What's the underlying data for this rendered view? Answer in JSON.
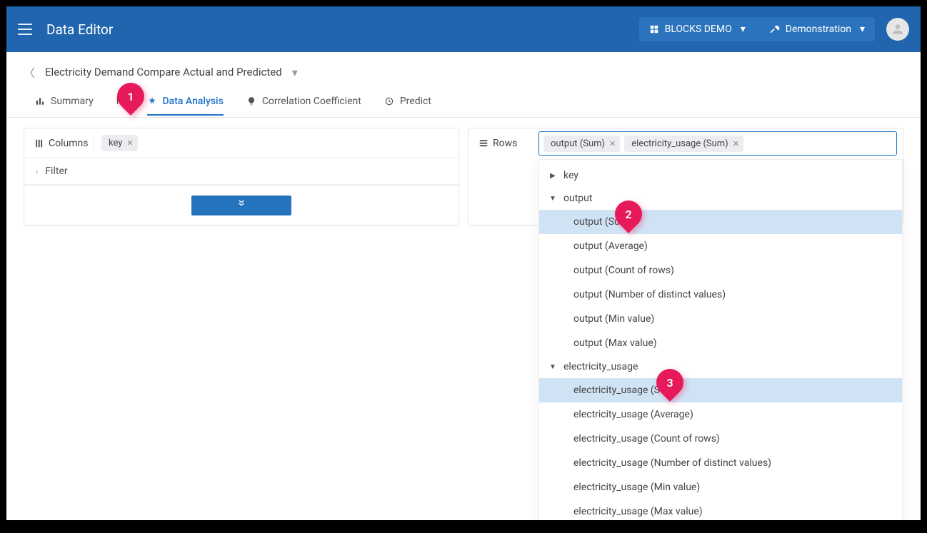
{
  "header": {
    "app_title": "Data Editor",
    "crumb1": "BLOCKS DEMO",
    "crumb2": "Demonstration"
  },
  "subheader": {
    "page_title": "Electricity Demand Compare Actual and Predicted"
  },
  "tabs": [
    {
      "id": "summary",
      "label": "Summary"
    },
    {
      "id": "table",
      "label": "le"
    },
    {
      "id": "data-analysis",
      "label": "Data Analysis"
    },
    {
      "id": "correlation",
      "label": "Correlation Coefficient"
    },
    {
      "id": "predict",
      "label": "Predict"
    }
  ],
  "columns": {
    "label": "Columns",
    "chips": [
      "key"
    ]
  },
  "rows": {
    "label": "Rows",
    "chips": [
      "output (Sum)",
      "electricity_usage (Sum)"
    ]
  },
  "filter": {
    "label": "Filter"
  },
  "dropdown": {
    "sections": [
      {
        "name": "key",
        "expanded": false,
        "items": []
      },
      {
        "name": "output",
        "expanded": true,
        "items": [
          {
            "label": "output (Sum)",
            "selected": true
          },
          {
            "label": "output (Average)",
            "selected": false
          },
          {
            "label": "output (Count of rows)",
            "selected": false
          },
          {
            "label": "output (Number of distinct values)",
            "selected": false
          },
          {
            "label": "output (Min value)",
            "selected": false
          },
          {
            "label": "output (Max value)",
            "selected": false
          }
        ]
      },
      {
        "name": "electricity_usage",
        "expanded": true,
        "items": [
          {
            "label": "electricity_usage (Sum)",
            "selected": true
          },
          {
            "label": "electricity_usage (Average)",
            "selected": false
          },
          {
            "label": "electricity_usage (Count of rows)",
            "selected": false
          },
          {
            "label": "electricity_usage (Number of distinct values)",
            "selected": false
          },
          {
            "label": "electricity_usage (Min value)",
            "selected": false
          },
          {
            "label": "electricity_usage (Max value)",
            "selected": false
          }
        ]
      }
    ]
  },
  "markers": [
    "1",
    "2",
    "3"
  ]
}
